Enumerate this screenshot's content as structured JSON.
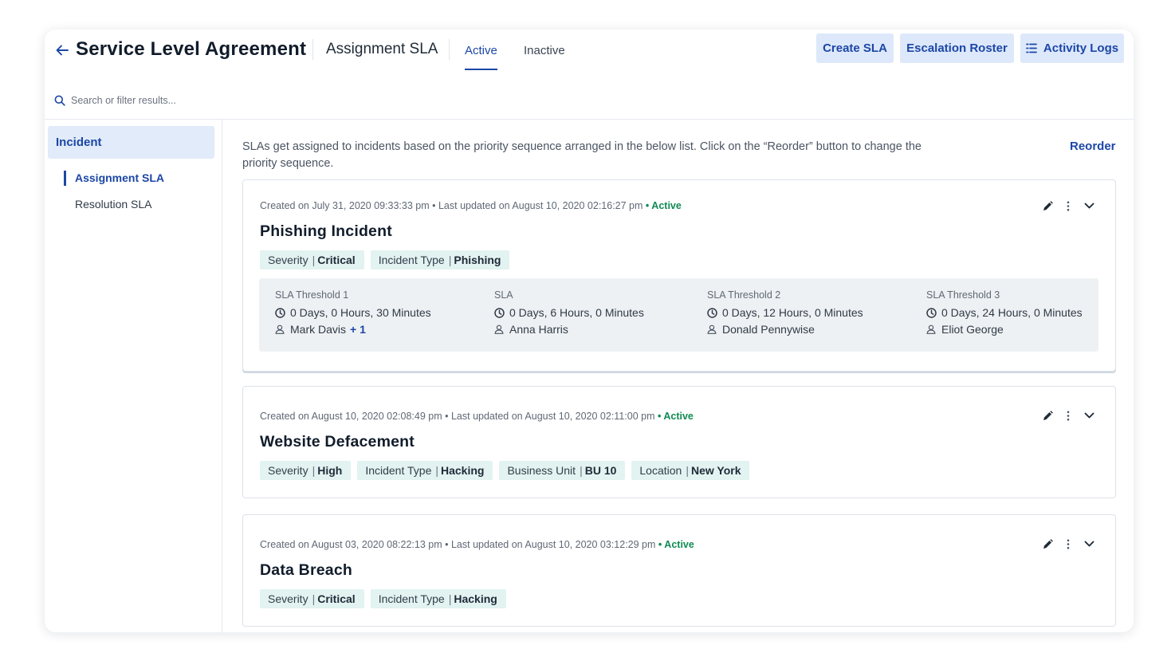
{
  "header": {
    "title": "Service Level Agreement",
    "subtitle": "Assignment SLA",
    "tabs": [
      {
        "label": "Active",
        "active": true
      },
      {
        "label": "Inactive",
        "active": false
      }
    ],
    "buttons": {
      "create": "Create SLA",
      "escalation": "Escalation Roster",
      "activity": "Activity Logs"
    }
  },
  "search": {
    "placeholder": "Search or filter results..."
  },
  "sidebar": {
    "category": "Incident",
    "items": [
      {
        "label": "Assignment SLA",
        "active": true
      },
      {
        "label": "Resolution SLA",
        "active": false
      }
    ]
  },
  "main": {
    "info": "SLAs get assigned to incidents based on the priority sequence arranged in the below list. Click on the “Reorder” button to change the priority sequence.",
    "reorder": "Reorder",
    "cards": [
      {
        "meta": "Created on July 31, 2020 09:33:33 pm • Last updated on August 10, 2020 02:16:27 pm",
        "status": "• Active",
        "title": "Phishing Incident",
        "tags": [
          {
            "key": "Severity",
            "value": "Critical"
          },
          {
            "key": "Incident Type",
            "value": "Phishing"
          }
        ],
        "thresholds": [
          {
            "label": "SLA Threshold 1",
            "time": "0 Days, 0 Hours, 30 Minutes",
            "user": "Mark Davis",
            "extra": "+ 1"
          },
          {
            "label": "SLA",
            "time": "0 Days, 6 Hours, 0 Minutes",
            "user": "Anna Harris",
            "extra": ""
          },
          {
            "label": "SLA Threshold 2",
            "time": "0 Days, 12 Hours, 0 Minutes",
            "user": "Donald Pennywise",
            "extra": ""
          },
          {
            "label": "SLA Threshold 3",
            "time": "0 Days, 24 Hours, 0 Minutes",
            "user": "Eliot George",
            "extra": ""
          }
        ]
      },
      {
        "meta": "Created on August 10, 2020 02:08:49 pm • Last updated on August 10, 2020 02:11:00 pm",
        "status": "• Active",
        "title": "Website Defacement",
        "tags": [
          {
            "key": "Severity",
            "value": "High"
          },
          {
            "key": "Incident Type",
            "value": "Hacking"
          },
          {
            "key": "Business Unit",
            "value": "BU 10"
          },
          {
            "key": "Location",
            "value": "New York"
          }
        ]
      },
      {
        "meta": "Created on August 03, 2020 08:22:13 pm • Last updated on August 10, 2020 03:12:29 pm",
        "status": "• Active",
        "title": "Data Breach",
        "tags": [
          {
            "key": "Severity",
            "value": "Critical"
          },
          {
            "key": "Incident Type",
            "value": "Hacking"
          }
        ]
      }
    ]
  },
  "icons": {
    "back": "arrow-left-icon",
    "activity": "list-icon",
    "search": "search-icon",
    "edit": "pencil-icon",
    "more": "more-vertical-icon",
    "expand": "chevron-down-icon",
    "clock": "clock-icon",
    "user": "user-icon"
  },
  "colors": {
    "accent": "#1c47a6",
    "button_bg": "#dde8fa",
    "tag_bg": "#e2f3f1",
    "status_active": "#0f8a54",
    "panel_bg": "#eef1f3"
  }
}
